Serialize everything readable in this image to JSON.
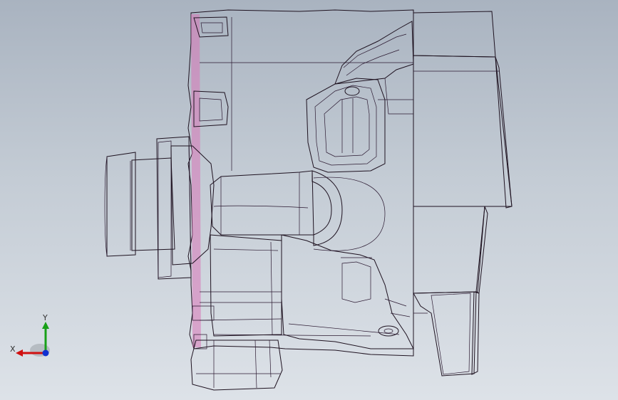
{
  "viewport": {
    "background_top": "#a9b3c0",
    "background_bottom": "#dde2e8"
  },
  "model": {
    "body_color": "#f59ad6",
    "shadow_color": "#c85a9e",
    "highlight_color": "#ffd6f0",
    "edge_color": "#1e1220"
  },
  "triad": {
    "x_label": "X",
    "y_label": "Y",
    "x_color": "#d01010",
    "y_color": "#18a018",
    "z_color": "#1030d0"
  }
}
